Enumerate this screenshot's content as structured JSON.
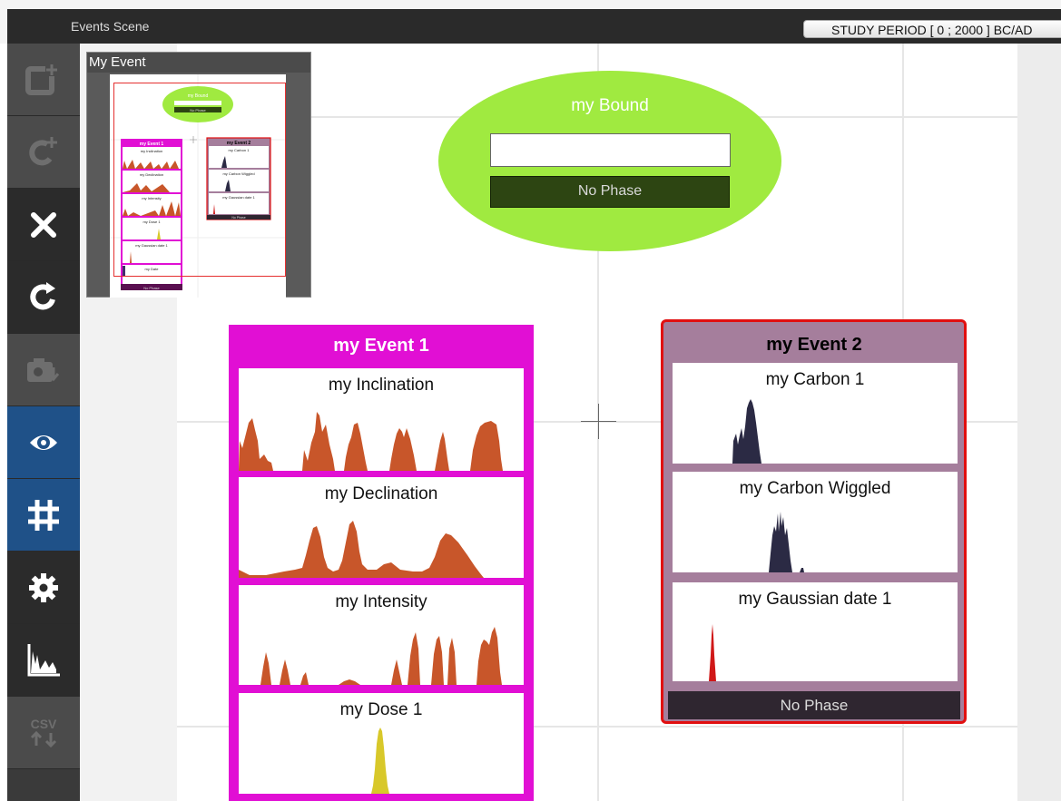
{
  "window": {
    "title": "Events Scene",
    "study_period": "STUDY PERIOD [ 0 ; 2000 ] BC/AD"
  },
  "toolbar": {
    "items": [
      {
        "name": "new-event-icon",
        "state": "disabled"
      },
      {
        "name": "new-bound-icon",
        "state": "disabled"
      },
      {
        "name": "delete-icon",
        "state": "normal"
      },
      {
        "name": "restore-icon",
        "state": "normal"
      },
      {
        "name": "export-image-icon",
        "state": "disabled"
      },
      {
        "name": "eye-icon",
        "state": "active"
      },
      {
        "name": "grid-icon",
        "state": "active"
      },
      {
        "name": "settings-gear-icon",
        "state": "normal"
      },
      {
        "name": "chronocurve-chart-icon",
        "state": "normal"
      },
      {
        "name": "csv-import-export-icon",
        "state": "disabled",
        "label": "CSV"
      }
    ]
  },
  "overview": {
    "title": "My Event",
    "bound_title": "my Bound",
    "bound_phase": "No Phase",
    "event1": {
      "title": "my Event 1",
      "cards": [
        "my Inclination",
        "my Declination",
        "my Intensity",
        "my Dose 1",
        "my Gaussian date 1",
        "my Date"
      ],
      "phase": "No Phase"
    },
    "event2": {
      "title": "my Event 2",
      "cards": [
        "my Carbon 1",
        "my Carbon Wiggled",
        "my Gaussian date 1"
      ],
      "phase": "No Phase"
    }
  },
  "bound": {
    "title": "my Bound",
    "input_value": "",
    "phase": "No Phase"
  },
  "event1": {
    "title": "my Event 1",
    "color": "#e10fd4",
    "dates": [
      {
        "label": "my Inclination",
        "color": "#c8562a"
      },
      {
        "label": "my Declination",
        "color": "#c8562a"
      },
      {
        "label": "my Intensity",
        "color": "#c8562a"
      },
      {
        "label": "my Dose 1",
        "color": "#d8c82a"
      }
    ]
  },
  "event2": {
    "title": "my Event 2",
    "color": "#a57e9c",
    "selected": true,
    "phase": "No Phase",
    "dates": [
      {
        "label": "my Carbon 1",
        "color": "#2b2a44"
      },
      {
        "label": "my Carbon Wiggled",
        "color": "#2b2a44"
      },
      {
        "label": "my Gaussian date 1",
        "color": "#d01818"
      }
    ]
  }
}
